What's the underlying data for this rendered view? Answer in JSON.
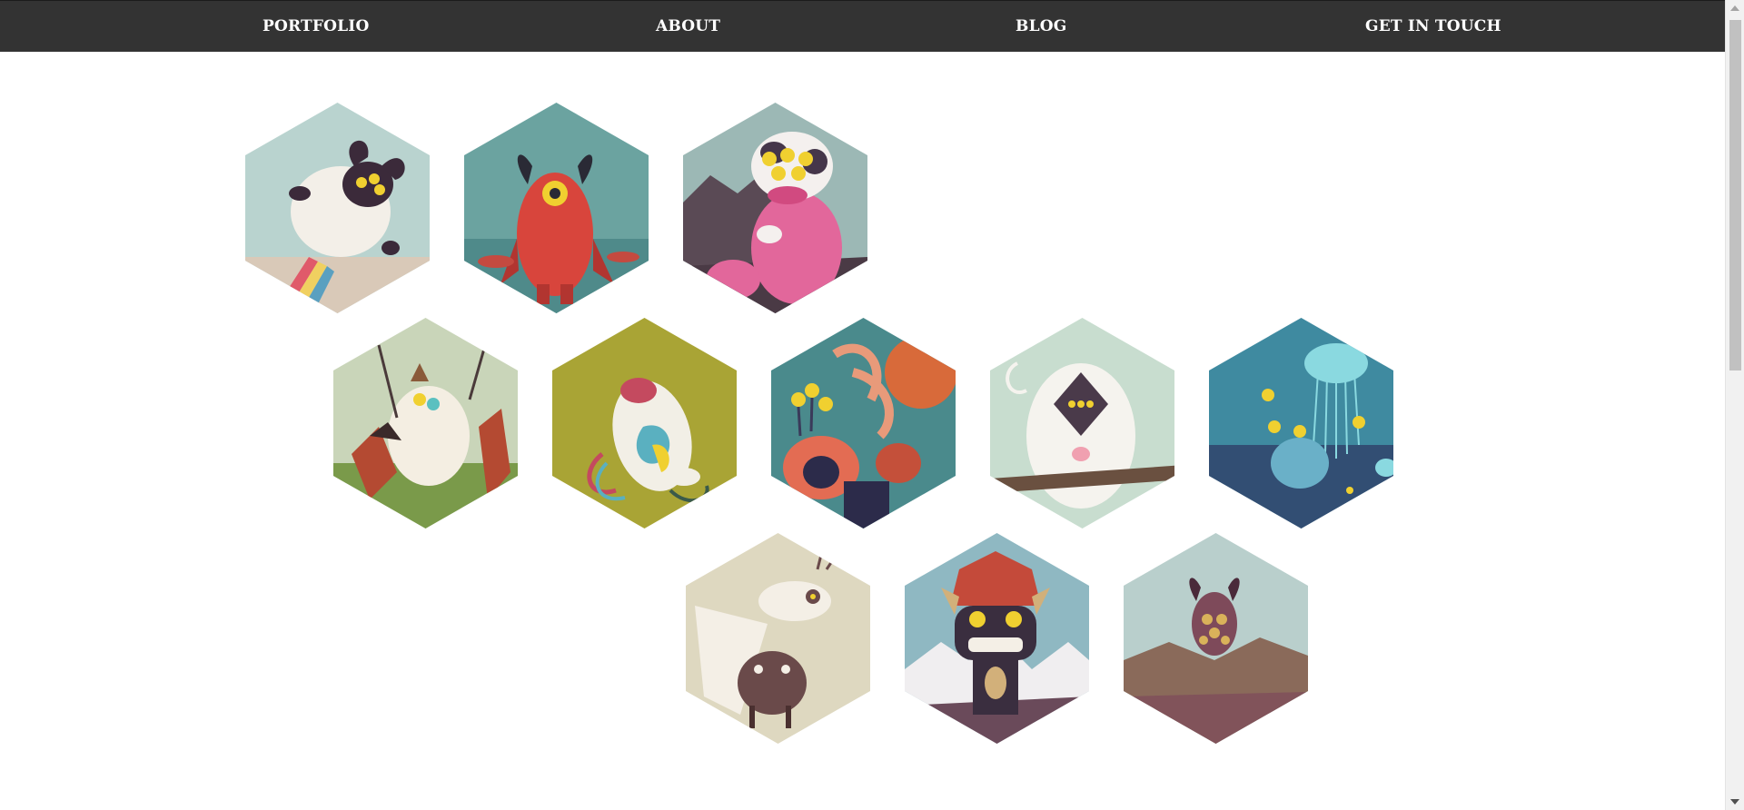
{
  "nav": {
    "portfolio": "PORTFOLIO",
    "about": "ABOUT",
    "blog": "BLOG",
    "contact": "GET IN TOUCH"
  },
  "colors": {
    "nav_background": "#333333",
    "nav_text": "#ffffff",
    "page_background": "#ffffff"
  },
  "gallery": {
    "items": [
      {
        "subject": "flying white sheep monster with horns",
        "palette": [
          "#b9d3cf",
          "#f3efe8",
          "#3b2a3a"
        ]
      },
      {
        "subject": "red horned cyclops monster by the sea",
        "palette": [
          "#6ba3a0",
          "#d8453c",
          "#2a2a35"
        ]
      },
      {
        "subject": "pink cow monster with many eyes in mountains",
        "palette": [
          "#9cb8b5",
          "#e2679b",
          "#45364a"
        ]
      },
      {
        "subject": "white creature fighting red beasts",
        "palette": [
          "#c9d5b9",
          "#f4eee2",
          "#b44a32"
        ]
      },
      {
        "subject": "white fish creature on green grass",
        "palette": [
          "#a9a435",
          "#f2efe6",
          "#c44a5f"
        ]
      },
      {
        "subject": "octopus and tentacle monsters",
        "palette": [
          "#4a8a8c",
          "#e36c53",
          "#2c2b4a"
        ]
      },
      {
        "subject": "white furry yeti on a branch",
        "palette": [
          "#c8ddcf",
          "#f5f3ee",
          "#4a3a4a"
        ]
      },
      {
        "subject": "jellyfish under blue water",
        "palette": [
          "#3f8aa0",
          "#8ad9e0",
          "#2e3560"
        ]
      },
      {
        "subject": "white bird monster carrying a creature",
        "palette": [
          "#ded8c0",
          "#f4efe6",
          "#6a4a4a"
        ]
      },
      {
        "subject": "tribal mask totem monster in mountains",
        "palette": [
          "#8fb8c2",
          "#d2b07a",
          "#3a2e3f"
        ]
      },
      {
        "subject": "small horned monster on a hill",
        "palette": [
          "#b9cfcc",
          "#7e4a5a",
          "#d9b25a"
        ]
      }
    ]
  }
}
